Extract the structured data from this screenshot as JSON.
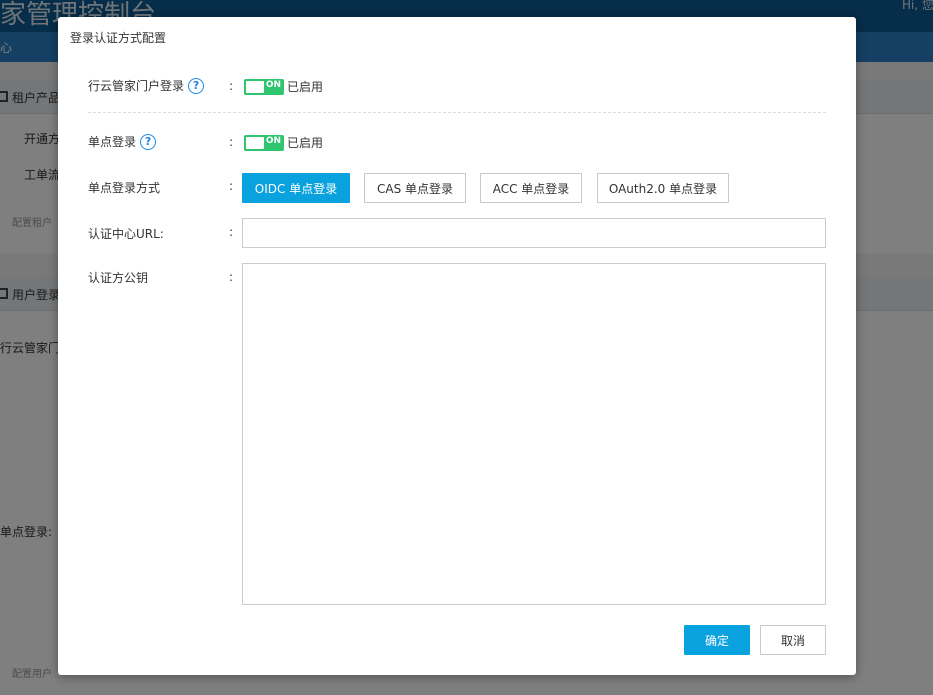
{
  "background": {
    "app_title": "家管理控制台",
    "greeting": "Hi, 您",
    "nav_item": "心",
    "section1_title": "租户产品",
    "section1_rows": [
      "开通方",
      "工单流"
    ],
    "section1_note": "配置租户",
    "section2_title": "用户登录",
    "section2_row": "行云管家门",
    "sso_label": "单点登录:",
    "footer_note": "配置用户"
  },
  "modal": {
    "title": "登录认证方式配置",
    "portal_login": {
      "label": "行云管家门户登录",
      "help": "?",
      "colon": ":",
      "toggle_text": "ON",
      "status": "已启用"
    },
    "sso": {
      "label": "单点登录",
      "help": "?",
      "colon": ":",
      "toggle_text": "ON",
      "status": "已启用"
    },
    "sso_method": {
      "label": "单点登录方式",
      "colon": ":",
      "options": [
        "OIDC 单点登录",
        "CAS 单点登录",
        "ACC 单点登录",
        "OAuth2.0 单点登录"
      ],
      "selected": "OIDC 单点登录"
    },
    "auth_url": {
      "label": "认证中心URL:",
      "colon": ":",
      "value": "",
      "placeholder": ""
    },
    "public_key": {
      "label": "认证方公钥",
      "colon": ":",
      "value": ""
    },
    "confirm_label": "确定",
    "cancel_label": "取消"
  },
  "colors": {
    "primary": "#0aa1df",
    "toggle_on": "#2fc46e",
    "header_bg": "#0c5a93",
    "nav_bg": "#2a7ec6",
    "help_icon": "#1e88e5"
  }
}
